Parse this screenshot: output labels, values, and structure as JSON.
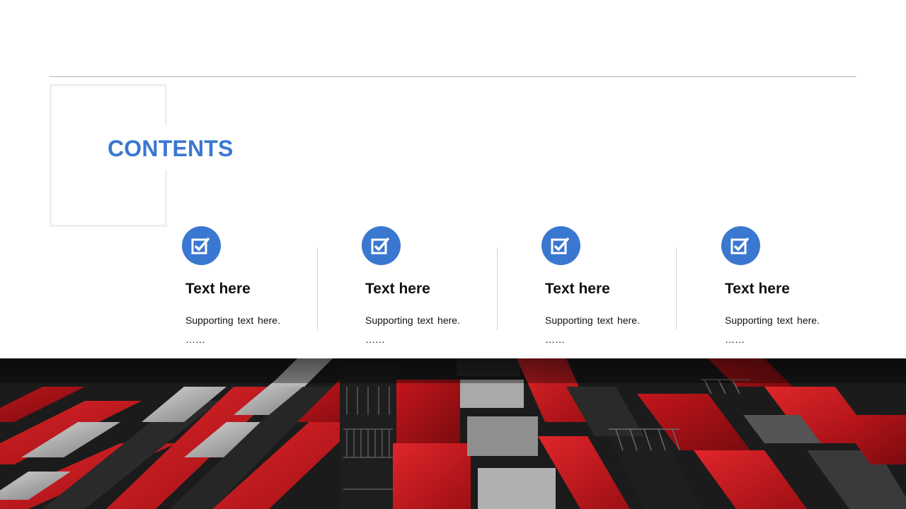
{
  "slide": {
    "title": "CONTENTS",
    "accent_color": "#3a77d0"
  },
  "items": [
    {
      "icon": "checkbox-edit-icon",
      "title": "Text here",
      "text": "Supporting text here.",
      "ellipsis": "……"
    },
    {
      "icon": "checkbox-edit-icon",
      "title": "Text here",
      "text": "Supporting text here.",
      "ellipsis": "……"
    },
    {
      "icon": "checkbox-edit-icon",
      "title": "Text here",
      "text": "Supporting text here.",
      "ellipsis": "……"
    },
    {
      "icon": "checkbox-edit-icon",
      "title": "Text here",
      "text": "Supporting text here.",
      "ellipsis": "……"
    }
  ],
  "photo": {
    "subject": "building-facade-image",
    "colors": [
      "#c4161c",
      "#1a1a1a",
      "#9a9a9a"
    ]
  }
}
